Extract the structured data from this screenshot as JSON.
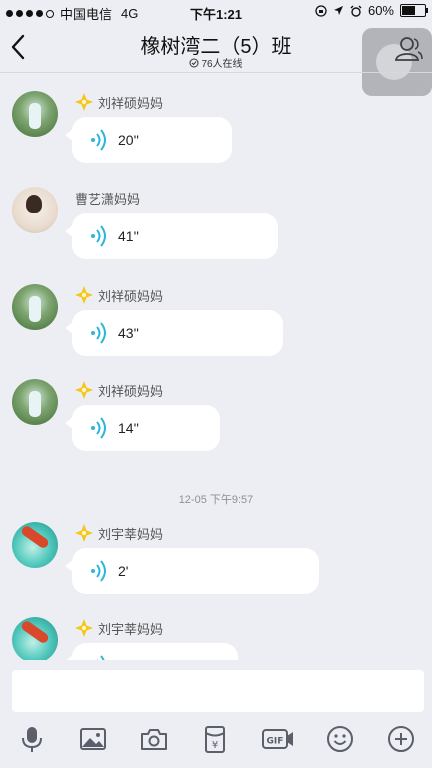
{
  "status_bar": {
    "carrier": "中国电信",
    "network": "4G",
    "time": "下午1:21",
    "battery_text": "60%",
    "battery_level": 0.6
  },
  "header": {
    "title": "橡树湾二（5）班",
    "online_count": "76人在线"
  },
  "messages": [
    {
      "sender": "刘祥硕妈妈",
      "duration": "20''",
      "badge": true,
      "avatar": "child-photo"
    },
    {
      "sender": "曹艺潇妈妈",
      "duration": "41''",
      "badge": false,
      "avatar": "woman-photo"
    },
    {
      "sender": "刘祥硕妈妈",
      "duration": "43''",
      "badge": true,
      "avatar": "child-photo"
    },
    {
      "sender": "刘祥硕妈妈",
      "duration": "14''",
      "badge": true,
      "avatar": "child-photo"
    },
    {
      "sender": "刘宇莘妈妈",
      "duration": "2'",
      "badge": true,
      "avatar": "fish-photo"
    },
    {
      "sender": "刘宇莘妈妈",
      "duration": "",
      "badge": true,
      "avatar": "fish-photo"
    }
  ],
  "timestamp": "12-05 下午9:57",
  "input": {
    "value": "",
    "placeholder": ""
  },
  "toolbar_icons": [
    "microphone-icon",
    "image-icon",
    "camera-icon",
    "red-packet-icon",
    "gif-icon",
    "emoji-icon",
    "plus-icon"
  ],
  "colors": {
    "accent": "#2bb8d6",
    "badge": "#f5c518",
    "background": "#eceef4"
  }
}
